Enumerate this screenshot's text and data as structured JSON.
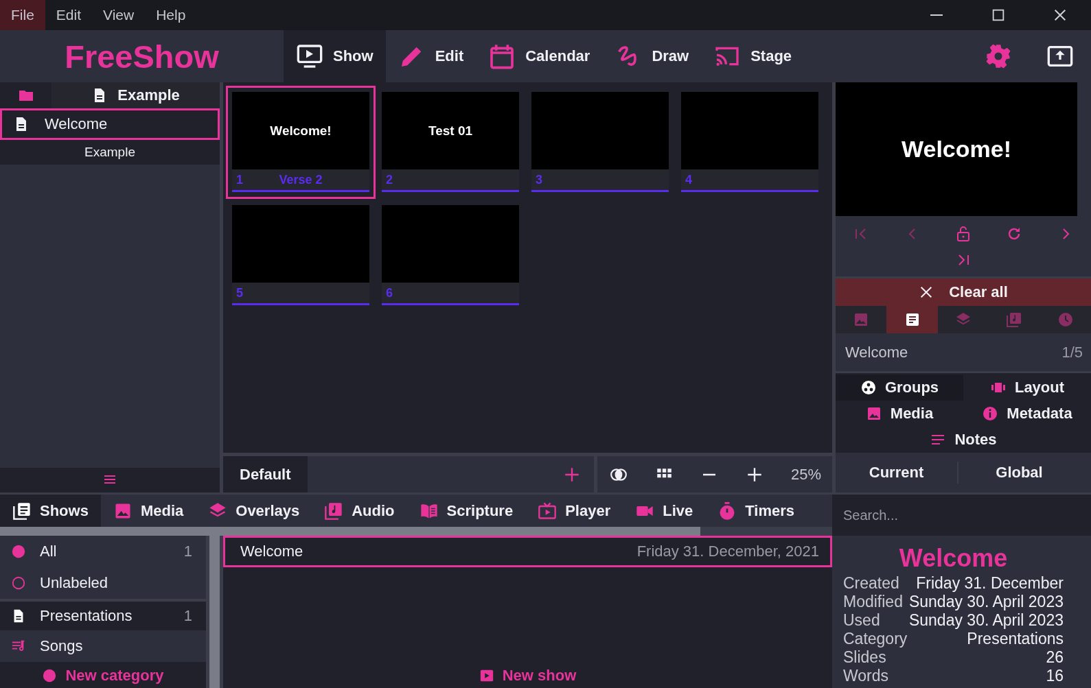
{
  "menu": [
    {
      "label": "File",
      "selected": true
    },
    {
      "label": "Edit",
      "selected": false
    },
    {
      "label": "View",
      "selected": false
    },
    {
      "label": "Help",
      "selected": false
    }
  ],
  "app_title": "FreeShow",
  "nav_tabs": [
    {
      "label": "Show",
      "selected": true
    },
    {
      "label": "Edit",
      "selected": false
    },
    {
      "label": "Calendar",
      "selected": false
    },
    {
      "label": "Draw",
      "selected": false
    },
    {
      "label": "Stage",
      "selected": false
    }
  ],
  "project_panel": {
    "tabs": [
      {
        "selected": false
      },
      {
        "label": "Example",
        "selected": true
      }
    ],
    "items": [
      {
        "name": "Welcome",
        "selected": true
      }
    ],
    "folder_label": "Example"
  },
  "slides": [
    {
      "number": "1",
      "group": "Verse 2",
      "text": "Welcome!",
      "selected": true
    },
    {
      "number": "2",
      "text": "Test 01",
      "selected": false
    },
    {
      "number": "3",
      "selected": false
    },
    {
      "number": "4",
      "selected": false
    },
    {
      "number": "5",
      "selected": false
    },
    {
      "number": "6",
      "selected": false
    }
  ],
  "layout_bar": {
    "layout": "Default",
    "zoom": "25%"
  },
  "preview": {
    "text": "Welcome!",
    "controls": [
      {
        "disabled": true
      },
      {
        "disabled": true
      },
      {
        "disabled": false
      },
      {
        "disabled": false
      },
      {
        "disabled": false
      },
      {
        "disabled": false
      }
    ],
    "clear_button": "Clear all",
    "output_tabs": [
      {
        "selected": false
      },
      {
        "selected": true
      },
      {
        "selected": false
      },
      {
        "selected": false
      },
      {
        "selected": false
      }
    ],
    "show_name": "Welcome",
    "slide_count": "1/5"
  },
  "tool_tabs": [
    {
      "label": "Groups",
      "selected": true
    },
    {
      "label": "Layout",
      "selected": false
    },
    {
      "label": "Media",
      "selected": false
    },
    {
      "label": "Metadata",
      "selected": false
    },
    {
      "label": "Notes",
      "selected": false
    }
  ],
  "group_tabs": [
    "Current",
    "Global"
  ],
  "drawer_tabs": [
    {
      "label": "Shows",
      "selected": true
    },
    {
      "label": "Media",
      "selected": false
    },
    {
      "label": "Overlays",
      "selected": false
    },
    {
      "label": "Audio",
      "selected": false
    },
    {
      "label": "Scripture",
      "selected": false
    },
    {
      "label": "Player",
      "selected": false
    },
    {
      "label": "Live",
      "selected": false
    },
    {
      "label": "Timers",
      "selected": false
    }
  ],
  "search": {
    "placeholder": "Search..."
  },
  "categories": [
    {
      "kind": "all",
      "name": "All",
      "count": "1"
    },
    {
      "kind": "unlabeled",
      "name": "Unlabeled"
    },
    {
      "kind": "presentations",
      "name": "Presentations",
      "count": "1"
    },
    {
      "kind": "songs",
      "name": "Songs"
    }
  ],
  "new_category": "New category",
  "shows": [
    {
      "name": "Welcome",
      "date": "Friday 31. December, 2021",
      "selected": true
    }
  ],
  "new_show": "New show",
  "info": {
    "title": "Welcome",
    "rows": [
      {
        "label": "Created",
        "value": "Friday 31. December"
      },
      {
        "label": "Modified",
        "value": "Sunday 30. April 2023"
      },
      {
        "label": "Used",
        "value": "Sunday 30. April 2023"
      },
      {
        "label": "Category",
        "value": "Presentations"
      },
      {
        "label": "Slides",
        "value": "26"
      },
      {
        "label": "Words",
        "value": "16"
      }
    ]
  }
}
